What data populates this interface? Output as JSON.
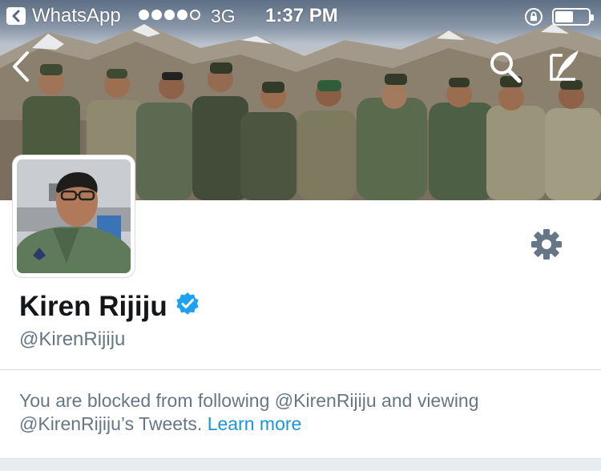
{
  "status_bar": {
    "back_app": "WhatsApp",
    "network": "3G",
    "time": "1:37 PM",
    "signal_bars_filled": 4,
    "signal_bars_total": 5
  },
  "header": {
    "back_icon": "chevron-left-icon",
    "search_icon": "search-icon",
    "compose_icon": "compose-tweet-icon"
  },
  "profile": {
    "display_name": "Kiren Rijiju",
    "verified": true,
    "handle": "@KirenRijiju",
    "settings_icon": "gear-icon"
  },
  "blocked_notice": {
    "text": "You are blocked from following @KirenRijiju and viewing @KirenRijiju’s Tweets.",
    "link_label": "Learn more"
  },
  "colors": {
    "link": "#1b95e0",
    "muted": "#657786",
    "verified": "#1da1f2",
    "icon_gray": "#657786"
  }
}
